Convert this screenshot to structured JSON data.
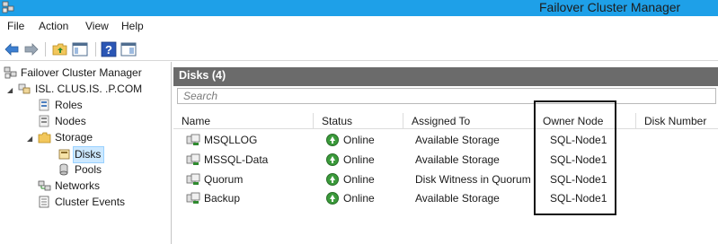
{
  "window": {
    "title": "Failover Cluster Manager",
    "app_icon": "cluster-icon"
  },
  "menu": [
    "File",
    "Action",
    "View",
    "Help"
  ],
  "toolbar": {
    "buttons": [
      "back-arrow-icon",
      "forward-arrow-icon",
      "folder-up-icon",
      "show-hide-tree-icon",
      "help-icon",
      "action-pane-icon"
    ]
  },
  "tree": {
    "root": "Failover Cluster Manager",
    "cluster": "ISL.          CLUS.IS.     .P.COM",
    "items": {
      "roles": "Roles",
      "nodes": "Nodes",
      "storage": "Storage",
      "disks": "Disks",
      "pools": "Pools",
      "networks": "Networks",
      "events": "Cluster Events"
    }
  },
  "content": {
    "header": "Disks (4)",
    "search_placeholder": "Search",
    "columns": [
      "Name",
      "Status",
      "Assigned To",
      "Owner Node",
      "Disk Number"
    ],
    "rows": [
      {
        "name": "MSQLLOG",
        "status": "Online",
        "assigned_to": "Available Storage",
        "owner_node": "SQL-Node1"
      },
      {
        "name": "MSSQL-Data",
        "status": "Online",
        "assigned_to": "Available Storage",
        "owner_node": "SQL-Node1"
      },
      {
        "name": "Quorum",
        "status": "Online",
        "assigned_to": "Disk Witness in Quorum",
        "owner_node": "SQL-Node1"
      },
      {
        "name": "Backup",
        "status": "Online",
        "assigned_to": "Available Storage",
        "owner_node": "SQL-Node1"
      }
    ]
  },
  "colors": {
    "titlebar": "#1ea0e8",
    "panel_header": "#6b6b6b",
    "online_status": "#3a9a3a",
    "selection": "#cce8ff"
  }
}
